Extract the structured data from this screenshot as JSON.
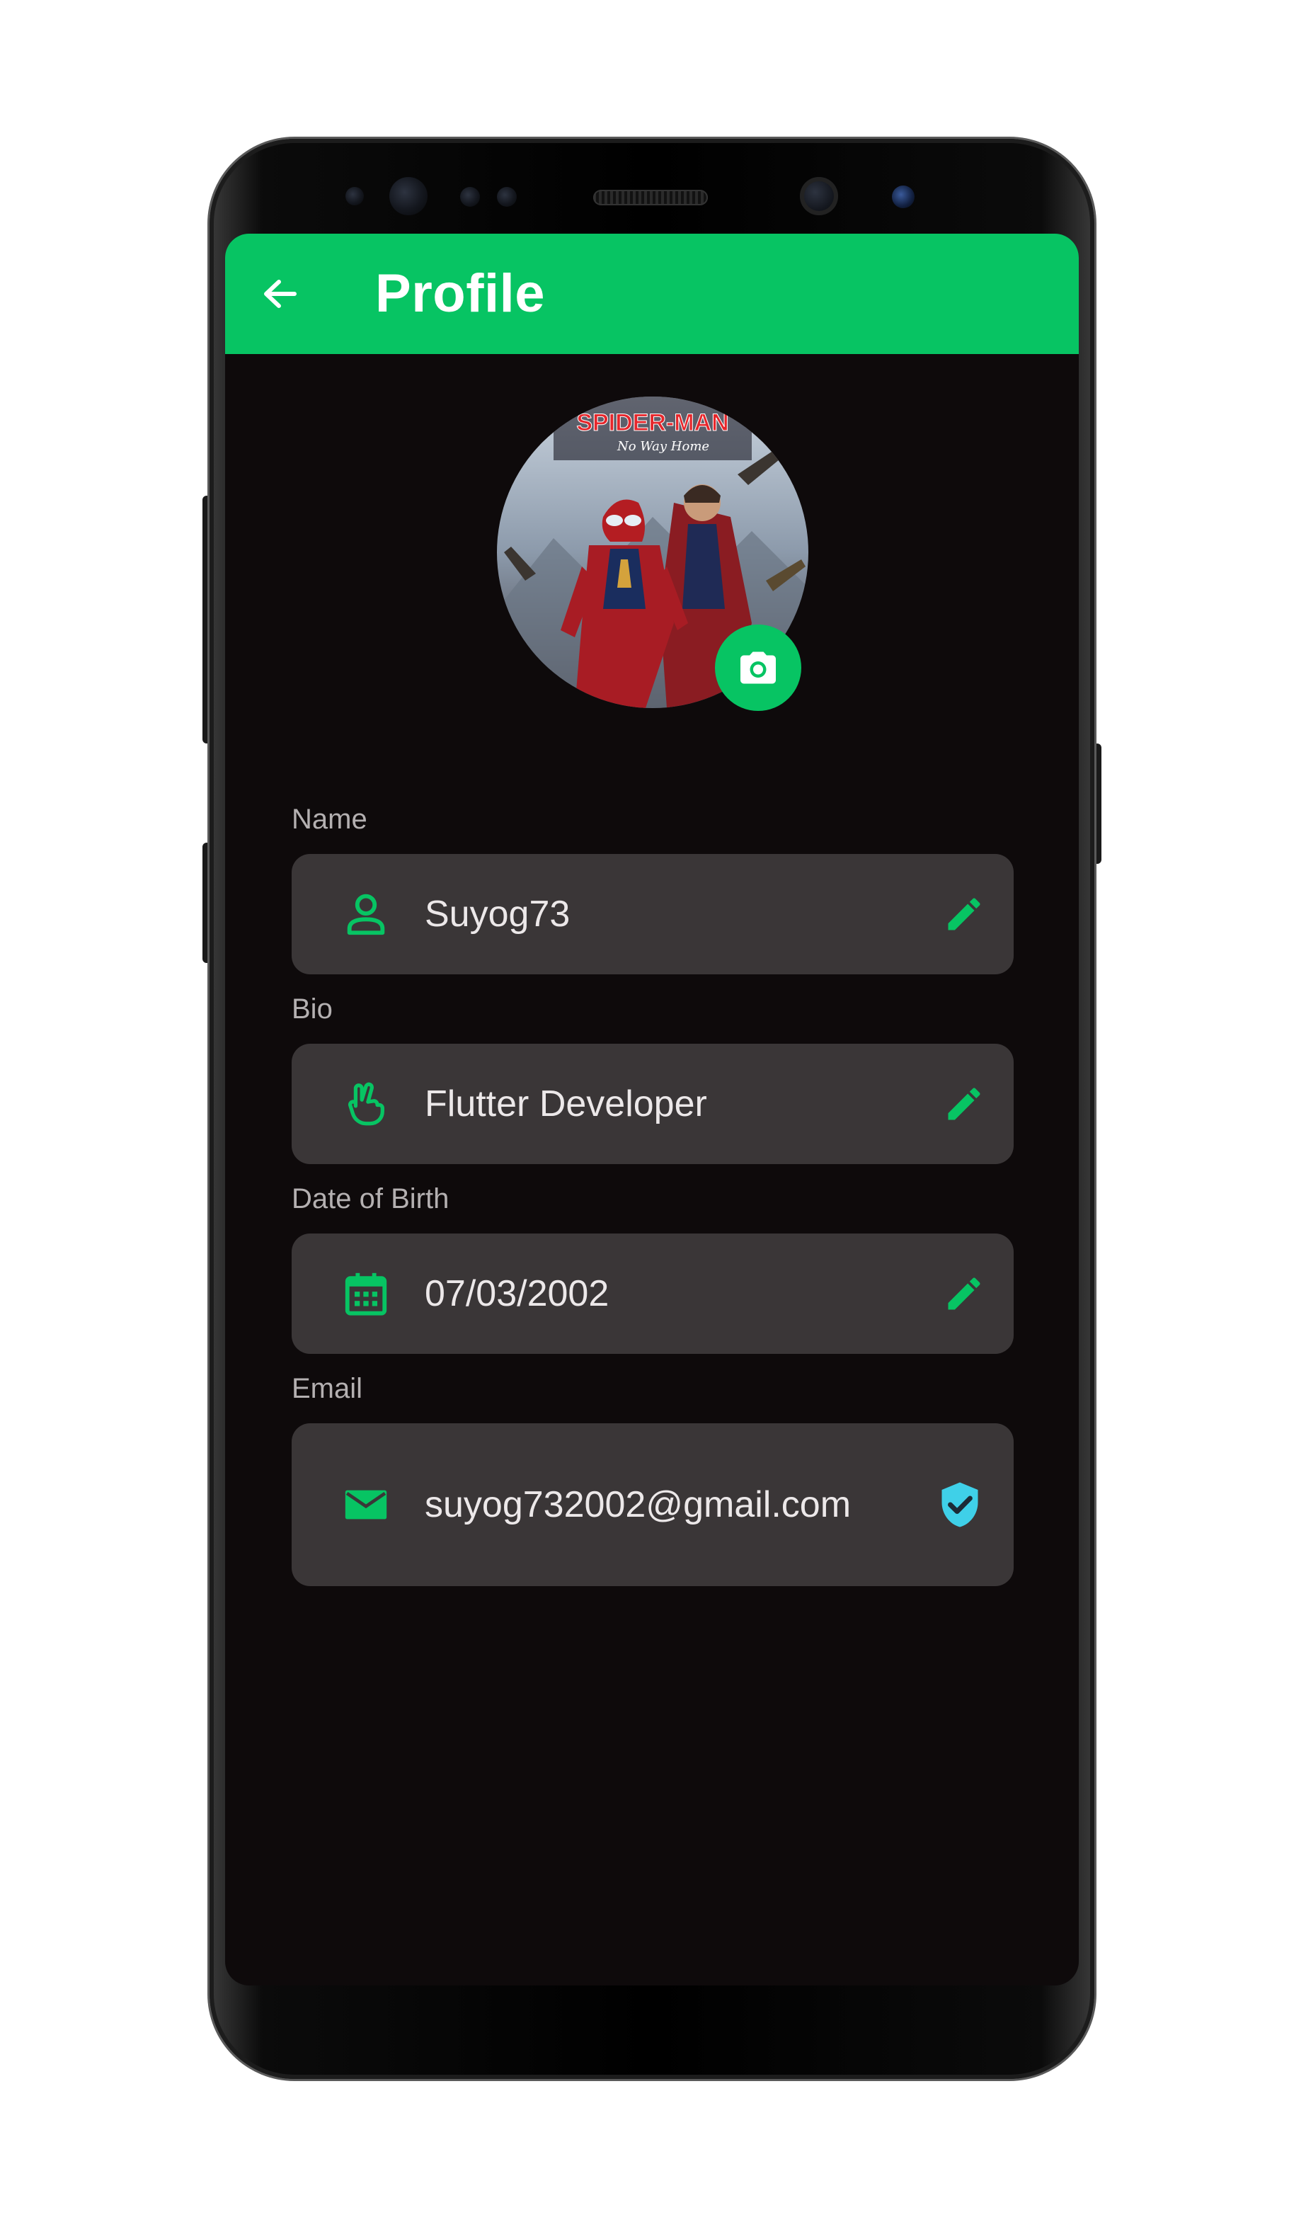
{
  "appbar": {
    "title": "Profile",
    "color": "#07c463"
  },
  "avatar": {
    "image": "movie-poster-avatar",
    "poster_title": "SPIDER-MAN",
    "poster_subtitle": "No Way Home"
  },
  "fields": [
    {
      "label": "Name",
      "value": "Suyog73",
      "icon": "person-icon",
      "action_icon": "edit-pencil-icon"
    },
    {
      "label": "Bio",
      "value": "Flutter Developer",
      "icon": "peace-hand-icon",
      "action_icon": "edit-pencil-icon"
    },
    {
      "label": "Date of Birth",
      "value": "07/03/2002",
      "icon": "calendar-icon",
      "action_icon": "edit-pencil-icon"
    },
    {
      "label": "Email",
      "value": "suyog732002@gmail.com",
      "icon": "mail-icon",
      "action_icon": "verified-shield-icon"
    }
  ],
  "colors": {
    "accent": "#07c463",
    "background": "#0e0a0b",
    "field_background": "#3a3637",
    "verified": "#3fd0e8"
  }
}
